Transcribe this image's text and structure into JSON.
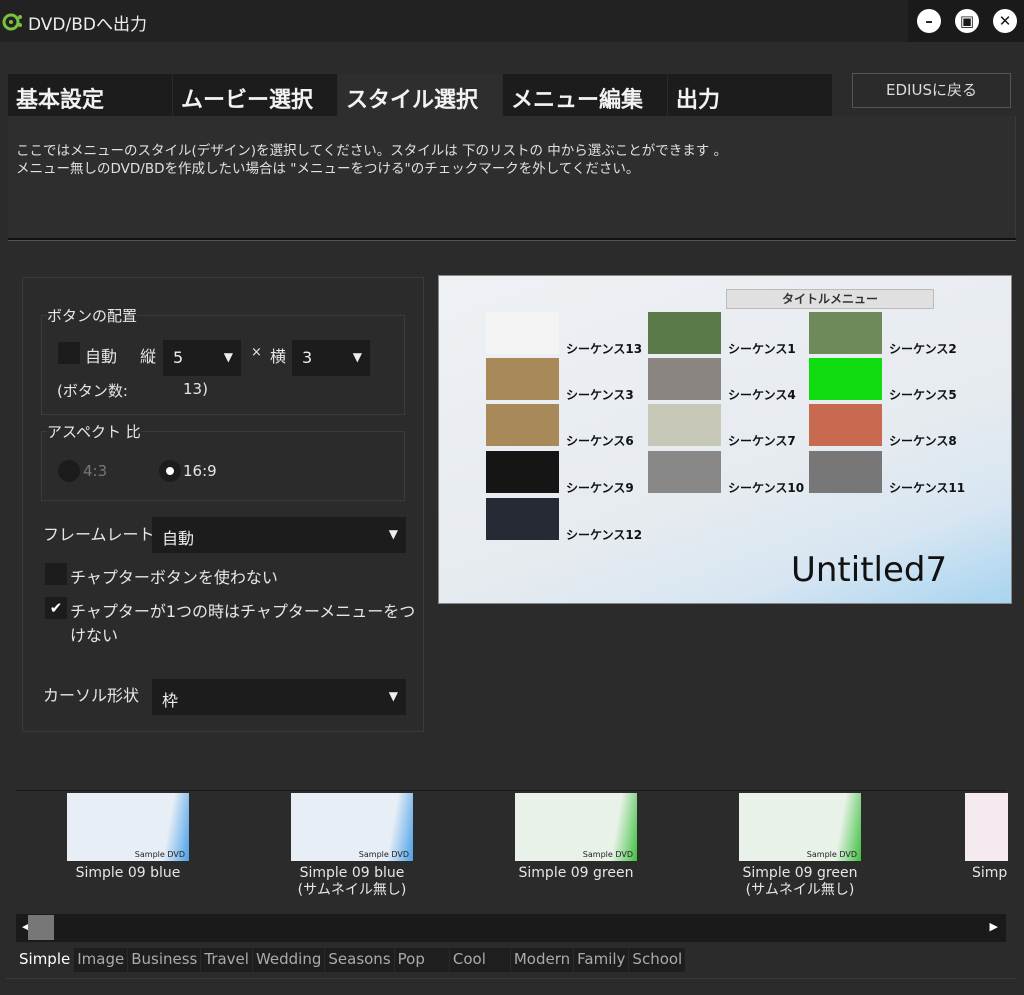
{
  "window": {
    "title": "DVD/BDへ出力",
    "controls": [
      "minimize",
      "maximize",
      "close"
    ]
  },
  "tabs": [
    {
      "label": "基本設定"
    },
    {
      "label": "ムービー選択"
    },
    {
      "label": "スタイル選択",
      "active": true
    },
    {
      "label": "メニュー編集"
    },
    {
      "label": "出力"
    }
  ],
  "edius_button": "EDIUSに戻る",
  "description": {
    "line1": "ここではメニューのスタイル(デザイン)を選択してください。スタイルは 下のリストの 中から選ぶことができます 。",
    "line2": "メニュー無しのDVD/BDを作成したい場合は \"メニューをつける\"のチェックマークを外してください。"
  },
  "layout_group": {
    "label": "ボタンの配置",
    "auto_label": "自動",
    "auto_checked": false,
    "rows_label": "縦",
    "rows_value": "5",
    "times": "×",
    "cols_label": "横",
    "cols_value": "3",
    "count_label": "(ボタン数:",
    "count_value": "13)"
  },
  "aspect_group": {
    "label": "アスペクト 比",
    "option_43": "4:3",
    "option_169": "16:9",
    "selected": "16:9"
  },
  "framerate": {
    "label": "フレームレート",
    "value": "自動"
  },
  "chapter_no_buttons": {
    "label": "チャプターボタンを使わない",
    "checked": false
  },
  "chapter_single": {
    "label": "チャプターが1つの時はチャプターメニューをつけない",
    "checked": true,
    "check_glyph": "✔"
  },
  "cursor": {
    "label": "カーソル形状",
    "value": "枠"
  },
  "preview": {
    "menu_title": "タイトルメニュー",
    "disc_title": "Untitled7",
    "items": [
      {
        "label": "シーケンス13",
        "color": "#f4f4f4"
      },
      {
        "label": "シーケンス1",
        "color": "#5b7a4a"
      },
      {
        "label": "シーケンス2",
        "color": "#6f8a5a"
      },
      {
        "label": "シーケンス3",
        "color": "#a88a5a"
      },
      {
        "label": "シーケンス4",
        "color": "#8a8580"
      },
      {
        "label": "シーケンス5",
        "color": "#10dd10"
      },
      {
        "label": "シーケンス6",
        "color": "#a88a5a"
      },
      {
        "label": "シーケンス7",
        "color": "#c8c8b8"
      },
      {
        "label": "シーケンス8",
        "color": "#c86a50"
      },
      {
        "label": "シーケンス9",
        "color": "#151515"
      },
      {
        "label": "シーケンス10",
        "color": "#888888"
      },
      {
        "label": "シーケンス11",
        "color": "#777777"
      },
      {
        "label": "シーケンス12",
        "color": "#262a35"
      }
    ]
  },
  "styles": [
    {
      "name": "Simple 09 blue",
      "sub": "",
      "accent": "#4aa0e8",
      "bg": "#e8eef6"
    },
    {
      "name": "Simple 09 blue",
      "sub": "(サムネイル無し)",
      "accent": "#4aa0e8",
      "bg": "#e8eef6"
    },
    {
      "name": "Simple 09 green",
      "sub": "",
      "accent": "#40c040",
      "bg": "#e8f2e8"
    },
    {
      "name": "Simple 09 green",
      "sub": "(サムネイル無し)",
      "accent": "#40c040",
      "bg": "#e8f2e8"
    },
    {
      "name": "Simp",
      "sub": "",
      "accent": "#e0a0c0",
      "bg": "#f4eaf0"
    }
  ],
  "style_thumb_text": "Sample DVD",
  "categories": [
    {
      "label": "Simple",
      "active": true
    },
    {
      "label": "Image"
    },
    {
      "label": "Business"
    },
    {
      "label": "Travel"
    },
    {
      "label": "Wedding"
    },
    {
      "label": "Seasons"
    },
    {
      "label": "Pop"
    },
    {
      "label": "Cool"
    },
    {
      "label": "Modern"
    },
    {
      "label": "Family"
    },
    {
      "label": "School"
    }
  ],
  "scroll": {
    "left": "◀",
    "right": "▶"
  }
}
